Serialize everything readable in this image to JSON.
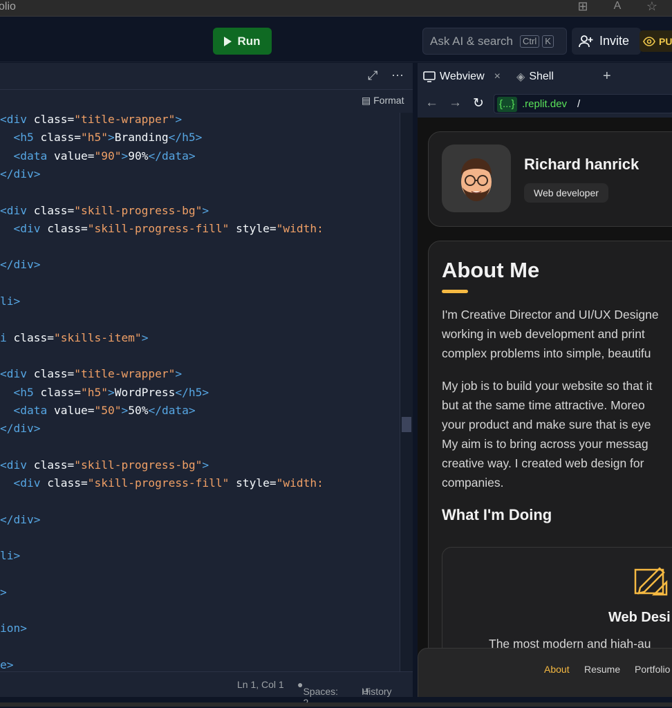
{
  "browser": {
    "tab_fragment": "olio"
  },
  "toolbar": {
    "run_label": "Run",
    "search_placeholder": "Ask AI & search",
    "kbd_ctrl": "Ctrl",
    "kbd_k": "K",
    "invite_label": "Invite",
    "public_badge": "PU"
  },
  "editor": {
    "format_label": "Format",
    "lines": [
      [
        [
          "tg",
          "<div "
        ],
        [
          "at",
          "class="
        ],
        [
          "st",
          "\"title-wrapper\""
        ],
        [
          "tg",
          ">"
        ]
      ],
      [
        [
          "pu",
          "  "
        ],
        [
          "tg",
          "<h5 "
        ],
        [
          "at",
          "class="
        ],
        [
          "st",
          "\"h5\""
        ],
        [
          "tg",
          ">"
        ],
        [
          "tx",
          "Branding"
        ],
        [
          "tg",
          "</h5>"
        ]
      ],
      [
        [
          "pu",
          "  "
        ],
        [
          "tg",
          "<data "
        ],
        [
          "at",
          "value="
        ],
        [
          "st",
          "\"90\""
        ],
        [
          "tg",
          ">"
        ],
        [
          "tx",
          "90%"
        ],
        [
          "tg",
          "</data>"
        ]
      ],
      [
        [
          "tg",
          "</div>"
        ]
      ],
      [],
      [
        [
          "tg",
          "<div "
        ],
        [
          "at",
          "class="
        ],
        [
          "st",
          "\"skill-progress-bg\""
        ],
        [
          "tg",
          ">"
        ]
      ],
      [
        [
          "pu",
          "  "
        ],
        [
          "tg",
          "<div "
        ],
        [
          "at",
          "class="
        ],
        [
          "st",
          "\"skill-progress-fill\""
        ],
        [
          "at",
          " style="
        ],
        [
          "st",
          "\"width:"
        ]
      ],
      [],
      [
        [
          "tg",
          "</div>"
        ]
      ],
      [],
      [
        [
          "tg",
          "li>"
        ]
      ],
      [],
      [
        [
          "tg",
          "i "
        ],
        [
          "at",
          "class="
        ],
        [
          "st",
          "\"skills-item\""
        ],
        [
          "tg",
          ">"
        ]
      ],
      [],
      [
        [
          "tg",
          "<div "
        ],
        [
          "at",
          "class="
        ],
        [
          "st",
          "\"title-wrapper\""
        ],
        [
          "tg",
          ">"
        ]
      ],
      [
        [
          "pu",
          "  "
        ],
        [
          "tg",
          "<h5 "
        ],
        [
          "at",
          "class="
        ],
        [
          "st",
          "\"h5\""
        ],
        [
          "tg",
          ">"
        ],
        [
          "tx",
          "WordPress"
        ],
        [
          "tg",
          "</h5>"
        ]
      ],
      [
        [
          "pu",
          "  "
        ],
        [
          "tg",
          "<data "
        ],
        [
          "at",
          "value="
        ],
        [
          "st",
          "\"50\""
        ],
        [
          "tg",
          ">"
        ],
        [
          "tx",
          "50%"
        ],
        [
          "tg",
          "</data>"
        ]
      ],
      [
        [
          "tg",
          "</div>"
        ]
      ],
      [],
      [
        [
          "tg",
          "<div "
        ],
        [
          "at",
          "class="
        ],
        [
          "st",
          "\"skill-progress-bg\""
        ],
        [
          "tg",
          ">"
        ]
      ],
      [
        [
          "pu",
          "  "
        ],
        [
          "tg",
          "<div "
        ],
        [
          "at",
          "class="
        ],
        [
          "st",
          "\"skill-progress-fill\""
        ],
        [
          "at",
          " style="
        ],
        [
          "st",
          "\"width:"
        ]
      ],
      [],
      [
        [
          "tg",
          "</div>"
        ]
      ],
      [],
      [
        [
          "tg",
          "li>"
        ]
      ],
      [],
      [
        [
          "tg",
          ">"
        ]
      ],
      [],
      [
        [
          "tg",
          "ion>"
        ]
      ],
      [],
      [
        [
          "tg",
          "e>"
        ]
      ]
    ],
    "status": {
      "position": "Ln 1, Col 1",
      "spaces": "Spaces: 2",
      "history": "History"
    }
  },
  "webview": {
    "tab_webview": "Webview",
    "tab_shell": "Shell",
    "url_tag": "{...}",
    "url_domain": ".replit.dev",
    "url_path": "/",
    "site": {
      "name": "Richard hanrick",
      "role": "Web developer",
      "about_title": "About Me",
      "para1": [
        "I'm Creative Director and UI/UX Designe",
        "working in web development and print",
        "complex problems into simple, beautifu"
      ],
      "para2": [
        "My job is to build your website so that it",
        "but at the same time attractive. Moreo",
        "your product and make sure that is eye",
        "My aim is to bring across your messag",
        "creative way. I created web design for",
        "companies."
      ],
      "doing_title": "What I'm Doing",
      "service_title": "Web Desi",
      "service_desc": "The most modern and hiah-au",
      "nav": [
        "About",
        "Resume",
        "Portfolio"
      ],
      "accent": "#f5b942"
    }
  }
}
